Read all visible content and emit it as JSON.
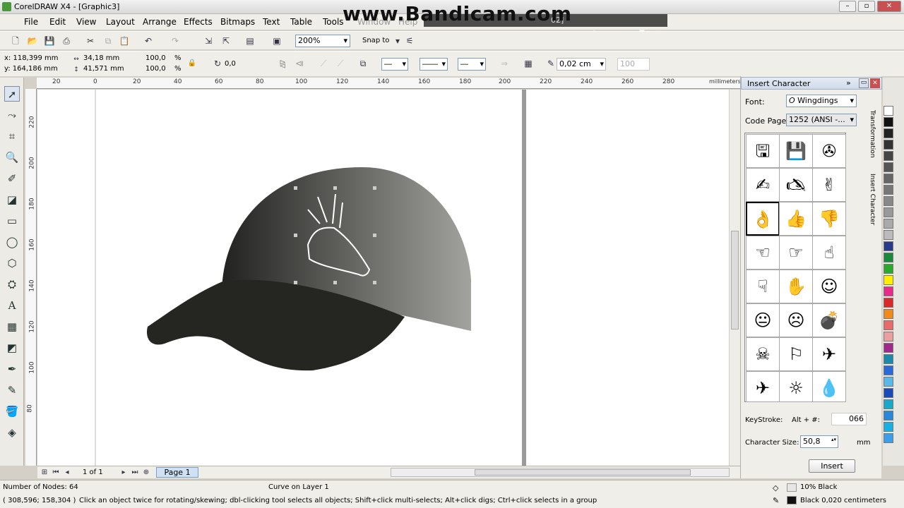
{
  "window": {
    "title": "CorelDRAW X4 - [Graphic3]",
    "watermark": "www.Bandicam.com",
    "rec_info": "02]"
  },
  "menu": [
    "File",
    "Edit",
    "View",
    "Layout",
    "Arrange",
    "Effects",
    "Bitmaps",
    "Text",
    "Table",
    "Tools",
    "Window",
    "Help"
  ],
  "toolbar": {
    "zoom": "200%",
    "snap": "Snap to"
  },
  "props": {
    "x": "x: 118,399 mm",
    "y": "y: 164,186 mm",
    "w": "34,18 mm",
    "h": "41,571 mm",
    "sx": "100,0",
    "sy": "100,0",
    "pct": "%",
    "angle": "0,0",
    "outline": "0,02 cm",
    "val100": "100"
  },
  "ruler": {
    "h": [
      "20",
      "0",
      "20",
      "40",
      "60",
      "80",
      "100",
      "120",
      "140",
      "160",
      "180",
      "200",
      "220",
      "240",
      "260",
      "280"
    ],
    "v": [
      "220",
      "200",
      "180",
      "160",
      "140",
      "120",
      "100",
      "80"
    ],
    "unit": "millimeters"
  },
  "docker": {
    "title": "Insert Character",
    "font_label": "Font:",
    "font_value": "Wingdings",
    "codepage_label": "Code Page:",
    "codepage_value": "1252  (ANSI -...",
    "glyphs": [
      "🖫",
      "💾",
      "✇",
      "✍",
      "🖎",
      "✌",
      "👌",
      "👍",
      "👎",
      "☜",
      "☞",
      "☝",
      "☟",
      "✋",
      "☺",
      "😐",
      "☹",
      "💣",
      "☠",
      "⚐",
      "✈",
      "☼",
      "💧"
    ],
    "keystroke_label": "KeyStroke:",
    "keystroke_alt": "Alt + #:",
    "keystroke_value": "066",
    "charsize_label": "Character Size:",
    "charsize_value": "50,8",
    "charsize_unit": "mm",
    "insert": "Insert",
    "tab_transformation": "Transformation",
    "tab_insert": "Insert Character"
  },
  "pagenav": {
    "count": "1 of 1",
    "page": "Page 1"
  },
  "status": {
    "nodes": "Number of Nodes: 64",
    "layer": "Curve on Layer 1",
    "coords": "( 308,596; 158,304 )",
    "hint": "Click an object twice for rotating/skewing; dbl-clicking tool selects all objects; Shift+click multi-selects; Alt+click digs; Ctrl+click selects in a group",
    "fill": "10% Black",
    "outline": "Black  0,020 centimeters"
  },
  "colors": {
    "cap_dark": "#222220",
    "cap_light": "#9a9a96"
  }
}
